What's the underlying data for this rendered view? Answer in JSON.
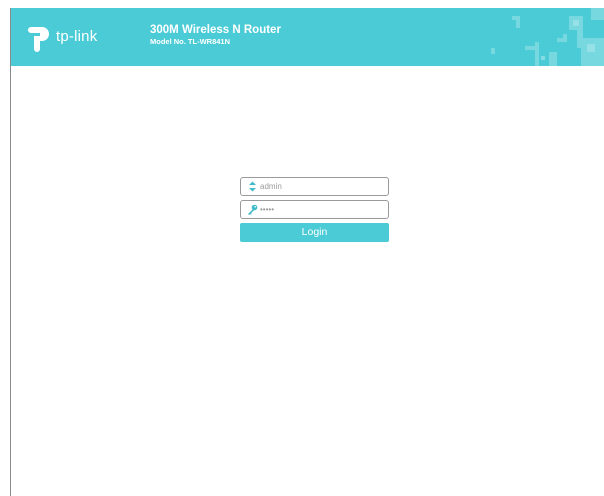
{
  "brand": {
    "logo_text": "tp-link",
    "accent_color": "#4acbd6"
  },
  "header": {
    "product_title": "300M Wireless N Router",
    "model_line": "Model No. TL-WR841N"
  },
  "login": {
    "username_value": "admin",
    "password_value": "•••••",
    "button_label": "Login",
    "username_icon": "user-icon",
    "password_icon": "key-icon"
  }
}
